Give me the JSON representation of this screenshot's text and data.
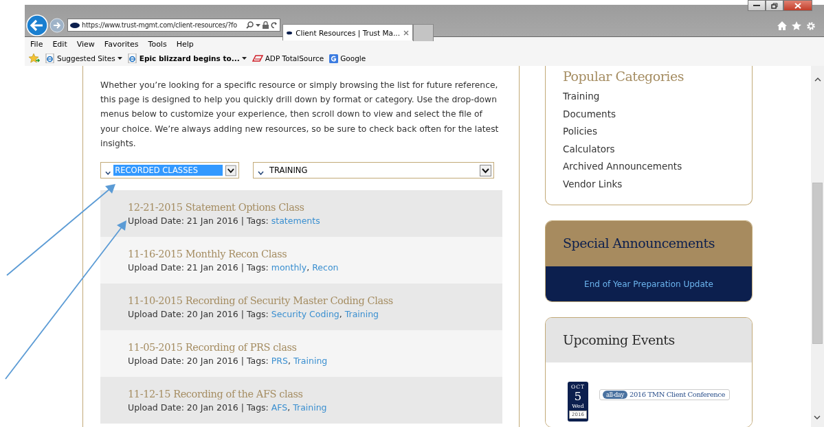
{
  "browser": {
    "address": "https://www.trust-mgmt.com/client-resources/?fo",
    "tab_title": "Client Resources | Trust Ma...",
    "menu": [
      "File",
      "Edit",
      "View",
      "Favorites",
      "Tools",
      "Help"
    ],
    "favorites": [
      {
        "label": "Suggested Sites",
        "kind": "ie",
        "bold": false,
        "dropdown": true
      },
      {
        "label": "Epic blizzard begins to...",
        "kind": "ie",
        "bold": true,
        "dropdown": true
      },
      {
        "label": "ADP TotalSource",
        "kind": "adp",
        "bold": false,
        "dropdown": false
      },
      {
        "label": "Google",
        "kind": "google",
        "bold": false,
        "dropdown": false
      }
    ]
  },
  "intro": "Whether you’re looking for a specific resource or simply browsing the list for future reference, this page is designed to help you quickly drill down by format or category. Use the drop-down menus below to customize your experience, then scroll down to view and select the file of your choice. We’re always adding new resources, so be sure to check back often for the latest insights.",
  "filters": [
    {
      "value": "RECORDED CLASSES",
      "focused": true
    },
    {
      "value": "TRAINING",
      "focused": false
    }
  ],
  "tag_separator": ",",
  "resources": [
    {
      "title": "12-21-2015 Statement Options Class",
      "meta": "Upload Date: 21 Jan 2016 | Tags:",
      "tags": [
        "statements"
      ]
    },
    {
      "title": "11-16-2015 Monthly Recon Class",
      "meta": "Upload Date: 21 Jan 2016 | Tags:",
      "tags": [
        "monthly",
        "Recon"
      ]
    },
    {
      "title": "11-10-2015 Recording of Security Master Coding Class",
      "meta": "Upload Date: 20 Jan 2016 | Tags:",
      "tags": [
        "Security Coding",
        "Training"
      ]
    },
    {
      "title": "11-05-2015 Recording of PRS class",
      "meta": "Upload Date: 20 Jan 2016 | Tags:",
      "tags": [
        "PRS",
        "Training"
      ]
    },
    {
      "title": "11-12-15 Recording of the AFS class",
      "meta": "Upload Date: 20 Jan 2016 | Tags:",
      "tags": [
        "AFS",
        "Training"
      ]
    }
  ],
  "popular_categories": {
    "title": "Popular Categories",
    "items": [
      "Training",
      "Documents",
      "Policies",
      "Calculators",
      "Archived Announcements",
      "Vendor Links"
    ]
  },
  "announcements": {
    "title": "Special Announcements",
    "items": [
      "End of Year Preparation Update"
    ]
  },
  "events": {
    "title": "Upcoming Events",
    "items": [
      {
        "month": "OCT",
        "day": "5",
        "weekday": "Wed",
        "year": "2016",
        "badge": "all-day",
        "title": "2016 TMN Client Conference"
      }
    ]
  }
}
